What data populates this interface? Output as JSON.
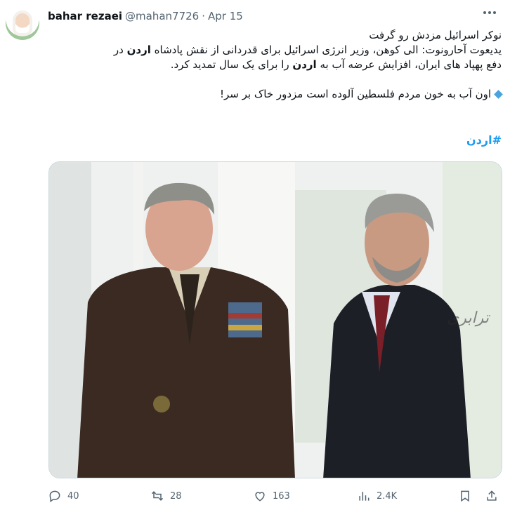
{
  "author": {
    "name": "bahar rezaei",
    "handle": "@mahan7726",
    "separator": "·",
    "date": "Apr 15"
  },
  "tweet": {
    "line1": "نوکر اسرائیل مزدش رو گرفت",
    "line2a": "یدیعوت آحارونوت: الی کوهن، وزیر انرژی اسرائیل برای قدردانی از نقش پادشاه ",
    "line2b": "اردن",
    "line2c": " در",
    "line3a": "دفع پهپاد های ایران، افزایش عرضه آب به ",
    "line3b": "اردن",
    "line3c": " را برای یک سال تمدید کرد.",
    "line4": "اون آب به خون مردم فلسطین آلوده است مزدور خاک بر سر!",
    "hashtag": "#اردن"
  },
  "photo": {
    "watermark": "ترابری"
  },
  "actions": {
    "replies": "40",
    "reposts": "28",
    "likes": "163",
    "views": "2.4K"
  },
  "icons": [
    "more-icon",
    "reply-icon",
    "repost-icon",
    "like-icon",
    "views-icon",
    "bookmark-icon",
    "share-icon",
    "diamond-icon"
  ]
}
